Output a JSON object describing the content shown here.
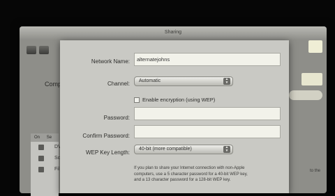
{
  "background_window": {
    "title": "Sharing",
    "partial_label": "Comp",
    "list_header": {
      "on": "On",
      "service": "Se"
    },
    "list_rows": [
      "DV",
      "Sc",
      "Fil"
    ],
    "right_partial_text": "to the"
  },
  "sheet": {
    "network_name": {
      "label": "Network Name:",
      "value": "alternatejohns"
    },
    "channel": {
      "label": "Channel:",
      "value": "Automatic"
    },
    "encryption": {
      "label": "Enable encryption (using WEP)",
      "checked": false
    },
    "password": {
      "label": "Password:",
      "value": ""
    },
    "confirm_password": {
      "label": "Confirm Password:",
      "value": ""
    },
    "wep_key_length": {
      "label": "WEP Key Length:",
      "value": "40-bit (more compatible)"
    },
    "info_lines": [
      "If you plan to share your Internet connection with non-Apple",
      "computers, use a 5 character password for a 40-bit WEP key,",
      "and a 13 character password for a 128-bit WEP key."
    ]
  }
}
